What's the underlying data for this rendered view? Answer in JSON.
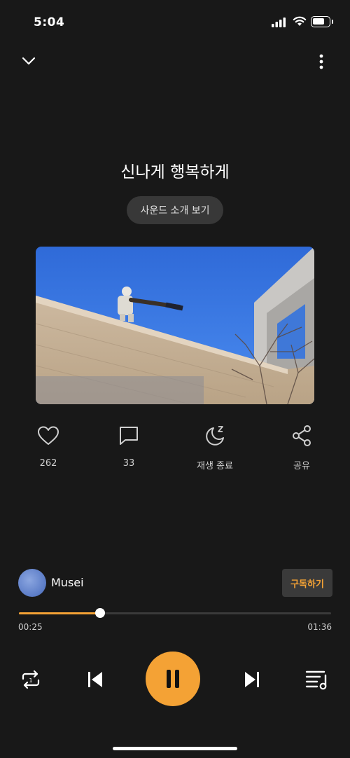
{
  "status_bar": {
    "time": "5:04"
  },
  "track": {
    "title": "신나게 행복하게",
    "sound_intro_label": "사운드 소개 보기"
  },
  "actions": {
    "like_count": "262",
    "comment_count": "33",
    "sleep_timer_label": "재생 종료",
    "share_label": "공유"
  },
  "channel": {
    "name": "Musei",
    "subscribe_label": "구독하기"
  },
  "progress": {
    "current": "00:25",
    "total": "01:36",
    "fraction": 0.26
  },
  "colors": {
    "accent": "#f4a235",
    "background": "#181818",
    "chip": "#383838"
  },
  "icons": [
    "chevron-down-icon",
    "more-vertical-icon",
    "heart-icon",
    "comment-icon",
    "moon-sleep-icon",
    "share-icon",
    "repeat-one-icon",
    "skip-previous-icon",
    "pause-icon",
    "skip-next-icon",
    "playlist-icon"
  ]
}
